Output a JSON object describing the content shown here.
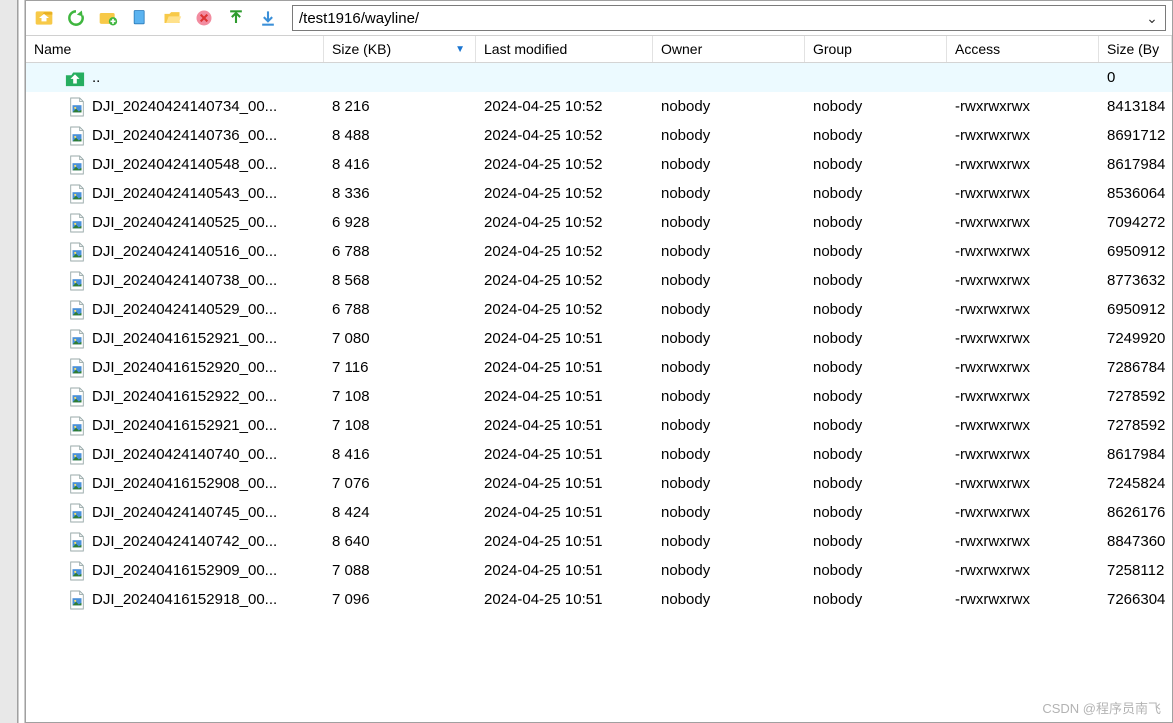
{
  "toolbar": {
    "path": "/test1916/wayline/"
  },
  "headers": {
    "name": "Name",
    "size": "Size (KB)",
    "last": "Last modified",
    "owner": "Owner",
    "group": "Group",
    "access": "Access",
    "bytes": "Size (By"
  },
  "parent_row": {
    "name": "..",
    "bytes": "0"
  },
  "files": [
    {
      "name": "DJI_20240424140734_00...",
      "size": "8 216",
      "last": "2024-04-25 10:52",
      "owner": "nobody",
      "group": "nobody",
      "access": "-rwxrwxrwx",
      "bytes": "8413184"
    },
    {
      "name": "DJI_20240424140736_00...",
      "size": "8 488",
      "last": "2024-04-25 10:52",
      "owner": "nobody",
      "group": "nobody",
      "access": "-rwxrwxrwx",
      "bytes": "8691712"
    },
    {
      "name": "DJI_20240424140548_00...",
      "size": "8 416",
      "last": "2024-04-25 10:52",
      "owner": "nobody",
      "group": "nobody",
      "access": "-rwxrwxrwx",
      "bytes": "8617984"
    },
    {
      "name": "DJI_20240424140543_00...",
      "size": "8 336",
      "last": "2024-04-25 10:52",
      "owner": "nobody",
      "group": "nobody",
      "access": "-rwxrwxrwx",
      "bytes": "8536064"
    },
    {
      "name": "DJI_20240424140525_00...",
      "size": "6 928",
      "last": "2024-04-25 10:52",
      "owner": "nobody",
      "group": "nobody",
      "access": "-rwxrwxrwx",
      "bytes": "7094272"
    },
    {
      "name": "DJI_20240424140516_00...",
      "size": "6 788",
      "last": "2024-04-25 10:52",
      "owner": "nobody",
      "group": "nobody",
      "access": "-rwxrwxrwx",
      "bytes": "6950912"
    },
    {
      "name": "DJI_20240424140738_00...",
      "size": "8 568",
      "last": "2024-04-25 10:52",
      "owner": "nobody",
      "group": "nobody",
      "access": "-rwxrwxrwx",
      "bytes": "8773632"
    },
    {
      "name": "DJI_20240424140529_00...",
      "size": "6 788",
      "last": "2024-04-25 10:52",
      "owner": "nobody",
      "group": "nobody",
      "access": "-rwxrwxrwx",
      "bytes": "6950912"
    },
    {
      "name": "DJI_20240416152921_00...",
      "size": "7 080",
      "last": "2024-04-25 10:51",
      "owner": "nobody",
      "group": "nobody",
      "access": "-rwxrwxrwx",
      "bytes": "7249920"
    },
    {
      "name": "DJI_20240416152920_00...",
      "size": "7 116",
      "last": "2024-04-25 10:51",
      "owner": "nobody",
      "group": "nobody",
      "access": "-rwxrwxrwx",
      "bytes": "7286784"
    },
    {
      "name": "DJI_20240416152922_00...",
      "size": "7 108",
      "last": "2024-04-25 10:51",
      "owner": "nobody",
      "group": "nobody",
      "access": "-rwxrwxrwx",
      "bytes": "7278592"
    },
    {
      "name": "DJI_20240416152921_00...",
      "size": "7 108",
      "last": "2024-04-25 10:51",
      "owner": "nobody",
      "group": "nobody",
      "access": "-rwxrwxrwx",
      "bytes": "7278592"
    },
    {
      "name": "DJI_20240424140740_00...",
      "size": "8 416",
      "last": "2024-04-25 10:51",
      "owner": "nobody",
      "group": "nobody",
      "access": "-rwxrwxrwx",
      "bytes": "8617984"
    },
    {
      "name": "DJI_20240416152908_00...",
      "size": "7 076",
      "last": "2024-04-25 10:51",
      "owner": "nobody",
      "group": "nobody",
      "access": "-rwxrwxrwx",
      "bytes": "7245824"
    },
    {
      "name": "DJI_20240424140745_00...",
      "size": "8 424",
      "last": "2024-04-25 10:51",
      "owner": "nobody",
      "group": "nobody",
      "access": "-rwxrwxrwx",
      "bytes": "8626176"
    },
    {
      "name": "DJI_20240424140742_00...",
      "size": "8 640",
      "last": "2024-04-25 10:51",
      "owner": "nobody",
      "group": "nobody",
      "access": "-rwxrwxrwx",
      "bytes": "8847360"
    },
    {
      "name": "DJI_20240416152909_00...",
      "size": "7 088",
      "last": "2024-04-25 10:51",
      "owner": "nobody",
      "group": "nobody",
      "access": "-rwxrwxrwx",
      "bytes": "7258112"
    },
    {
      "name": "DJI_20240416152918_00...",
      "size": "7 096",
      "last": "2024-04-25 10:51",
      "owner": "nobody",
      "group": "nobody",
      "access": "-rwxrwxrwx",
      "bytes": "7266304"
    }
  ],
  "watermark": "CSDN @程序员南飞"
}
